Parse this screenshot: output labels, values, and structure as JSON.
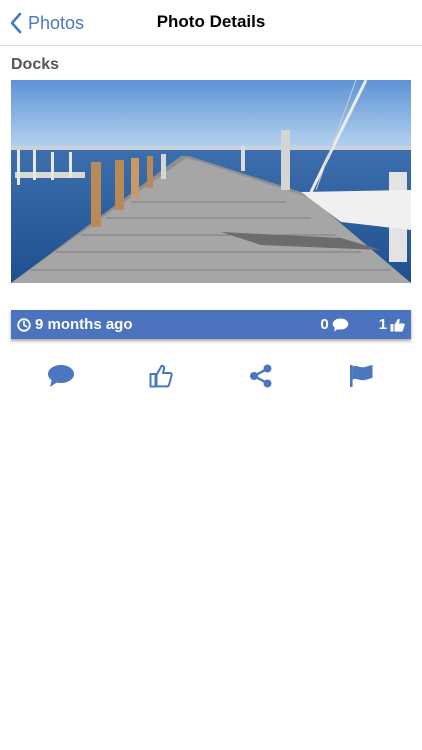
{
  "nav": {
    "back_label": "Photos",
    "title": "Photo Details"
  },
  "photo": {
    "title": "Docks"
  },
  "info": {
    "time_ago": "9 months ago",
    "comment_count": "0",
    "like_count": "1"
  },
  "actions": [
    "comment-icon",
    "thumbs-up-icon",
    "share-icon",
    "flag-icon"
  ],
  "colors": {
    "accent": "#4a77c0",
    "bar": "#4c73be"
  }
}
